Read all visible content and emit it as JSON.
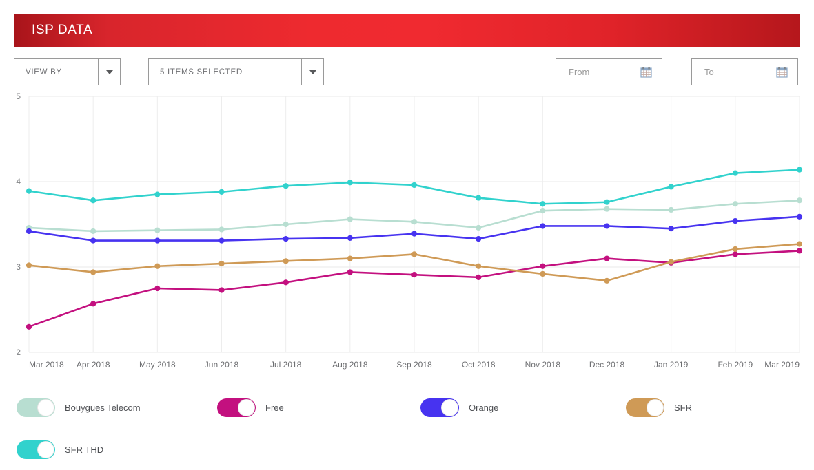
{
  "header": {
    "title": "ISP DATA",
    "accent_color": "#ee2a2f"
  },
  "filters": {
    "view_by": {
      "label": "VIEW BY",
      "icon": "chevron-down-icon"
    },
    "items": {
      "label": "5 ITEMS SELECTED",
      "icon": "chevron-down-icon"
    },
    "from": {
      "placeholder": "From",
      "value": "",
      "icon": "calendar-icon"
    },
    "to": {
      "placeholder": "To",
      "value": "",
      "icon": "calendar-icon"
    }
  },
  "legend": {
    "items": [
      {
        "label": "Bouygues Telecom",
        "color": "#b8ded1",
        "enabled": true
      },
      {
        "label": "Free",
        "color": "#c3107f",
        "enabled": true
      },
      {
        "label": "Orange",
        "color": "#4733f0",
        "enabled": true
      },
      {
        "label": "SFR",
        "color": "#cf9a56",
        "enabled": true
      },
      {
        "label": "SFR THD",
        "color": "#31d2cd",
        "enabled": true
      }
    ]
  },
  "chart_data": {
    "type": "line",
    "title": "",
    "xlabel": "",
    "ylabel": "",
    "ylim": [
      2,
      5
    ],
    "yticks": [
      2,
      3,
      4,
      5
    ],
    "grid": true,
    "legend_position": "bottom",
    "categories": [
      "Mar 2018",
      "Apr 2018",
      "May 2018",
      "Jun 2018",
      "Jul 2018",
      "Aug 2018",
      "Sep 2018",
      "Oct 2018",
      "Nov 2018",
      "Dec 2018",
      "Jan 2019",
      "Feb 2019",
      "Mar 2019"
    ],
    "series": [
      {
        "name": "Bouygues Telecom",
        "color": "#b8ded1",
        "values": [
          3.46,
          3.42,
          3.43,
          3.44,
          3.5,
          3.56,
          3.53,
          3.46,
          3.66,
          3.68,
          3.67,
          3.74,
          3.78
        ]
      },
      {
        "name": "Free",
        "color": "#c3107f",
        "values": [
          2.3,
          2.57,
          2.75,
          2.73,
          2.82,
          2.94,
          2.91,
          2.88,
          3.01,
          3.1,
          3.05,
          3.15,
          3.19
        ]
      },
      {
        "name": "Orange",
        "color": "#4733f0",
        "values": [
          3.42,
          3.31,
          3.31,
          3.31,
          3.33,
          3.34,
          3.39,
          3.33,
          3.48,
          3.48,
          3.45,
          3.54,
          3.59
        ]
      },
      {
        "name": "SFR",
        "color": "#cf9a56",
        "values": [
          3.02,
          2.94,
          3.01,
          3.04,
          3.07,
          3.1,
          3.15,
          3.01,
          2.92,
          2.84,
          3.06,
          3.21,
          3.27
        ]
      },
      {
        "name": "SFR THD",
        "color": "#31d2cd",
        "values": [
          3.89,
          3.78,
          3.85,
          3.88,
          3.95,
          3.99,
          3.96,
          3.81,
          3.74,
          3.76,
          3.94,
          4.1,
          4.14
        ]
      }
    ]
  }
}
